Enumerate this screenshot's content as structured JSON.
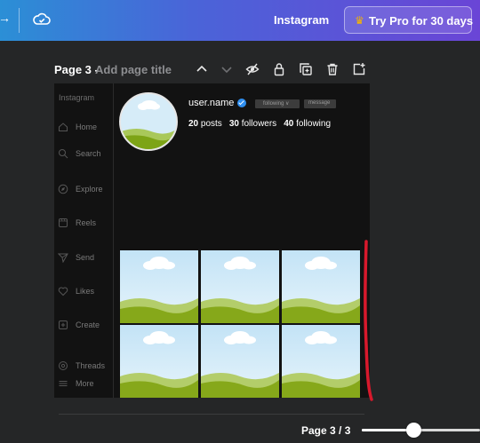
{
  "topbar": {
    "title": "Instagram",
    "pro_button_label": "Try Pro for 30 days",
    "arrow_glyph": "→",
    "crown_glyph": "♛"
  },
  "page_header": {
    "page_number": "Page 3 -",
    "add_title_placeholder": "Add page title"
  },
  "profile": {
    "sidebar_brand": "Instagram",
    "sidebar_items": [
      {
        "label": "Home",
        "icon": "home-icon"
      },
      {
        "label": "Search",
        "icon": "search-icon"
      },
      {
        "label": "Explore",
        "icon": "compass-icon"
      },
      {
        "label": "Reels",
        "icon": "reels-icon"
      },
      {
        "label": "Send",
        "icon": "send-icon"
      },
      {
        "label": "Likes",
        "icon": "heart-icon"
      },
      {
        "label": "Create",
        "icon": "plus-square-icon"
      },
      {
        "label": "Threads",
        "icon": "threads-icon"
      },
      {
        "label": "More",
        "icon": "menu-icon"
      }
    ],
    "username": "user.name",
    "following_button": "following ∨",
    "message_button": "message",
    "posts_count": "20",
    "posts_label": "posts",
    "followers_count": "30",
    "followers_label": "followers",
    "following_count": "40",
    "following_label": "following",
    "grid_tile_count": 6
  },
  "footer": {
    "pager_label": "Page 3 / 3",
    "zoom_level": 0.42
  },
  "colors": {
    "topbar_gradient": [
      "#2b8fd6",
      "#6a45d6"
    ],
    "accent_red": "#d8192c",
    "verified_blue": "#2f8ff0",
    "sky": "#cde9f8",
    "grass": "#8bb01f"
  }
}
